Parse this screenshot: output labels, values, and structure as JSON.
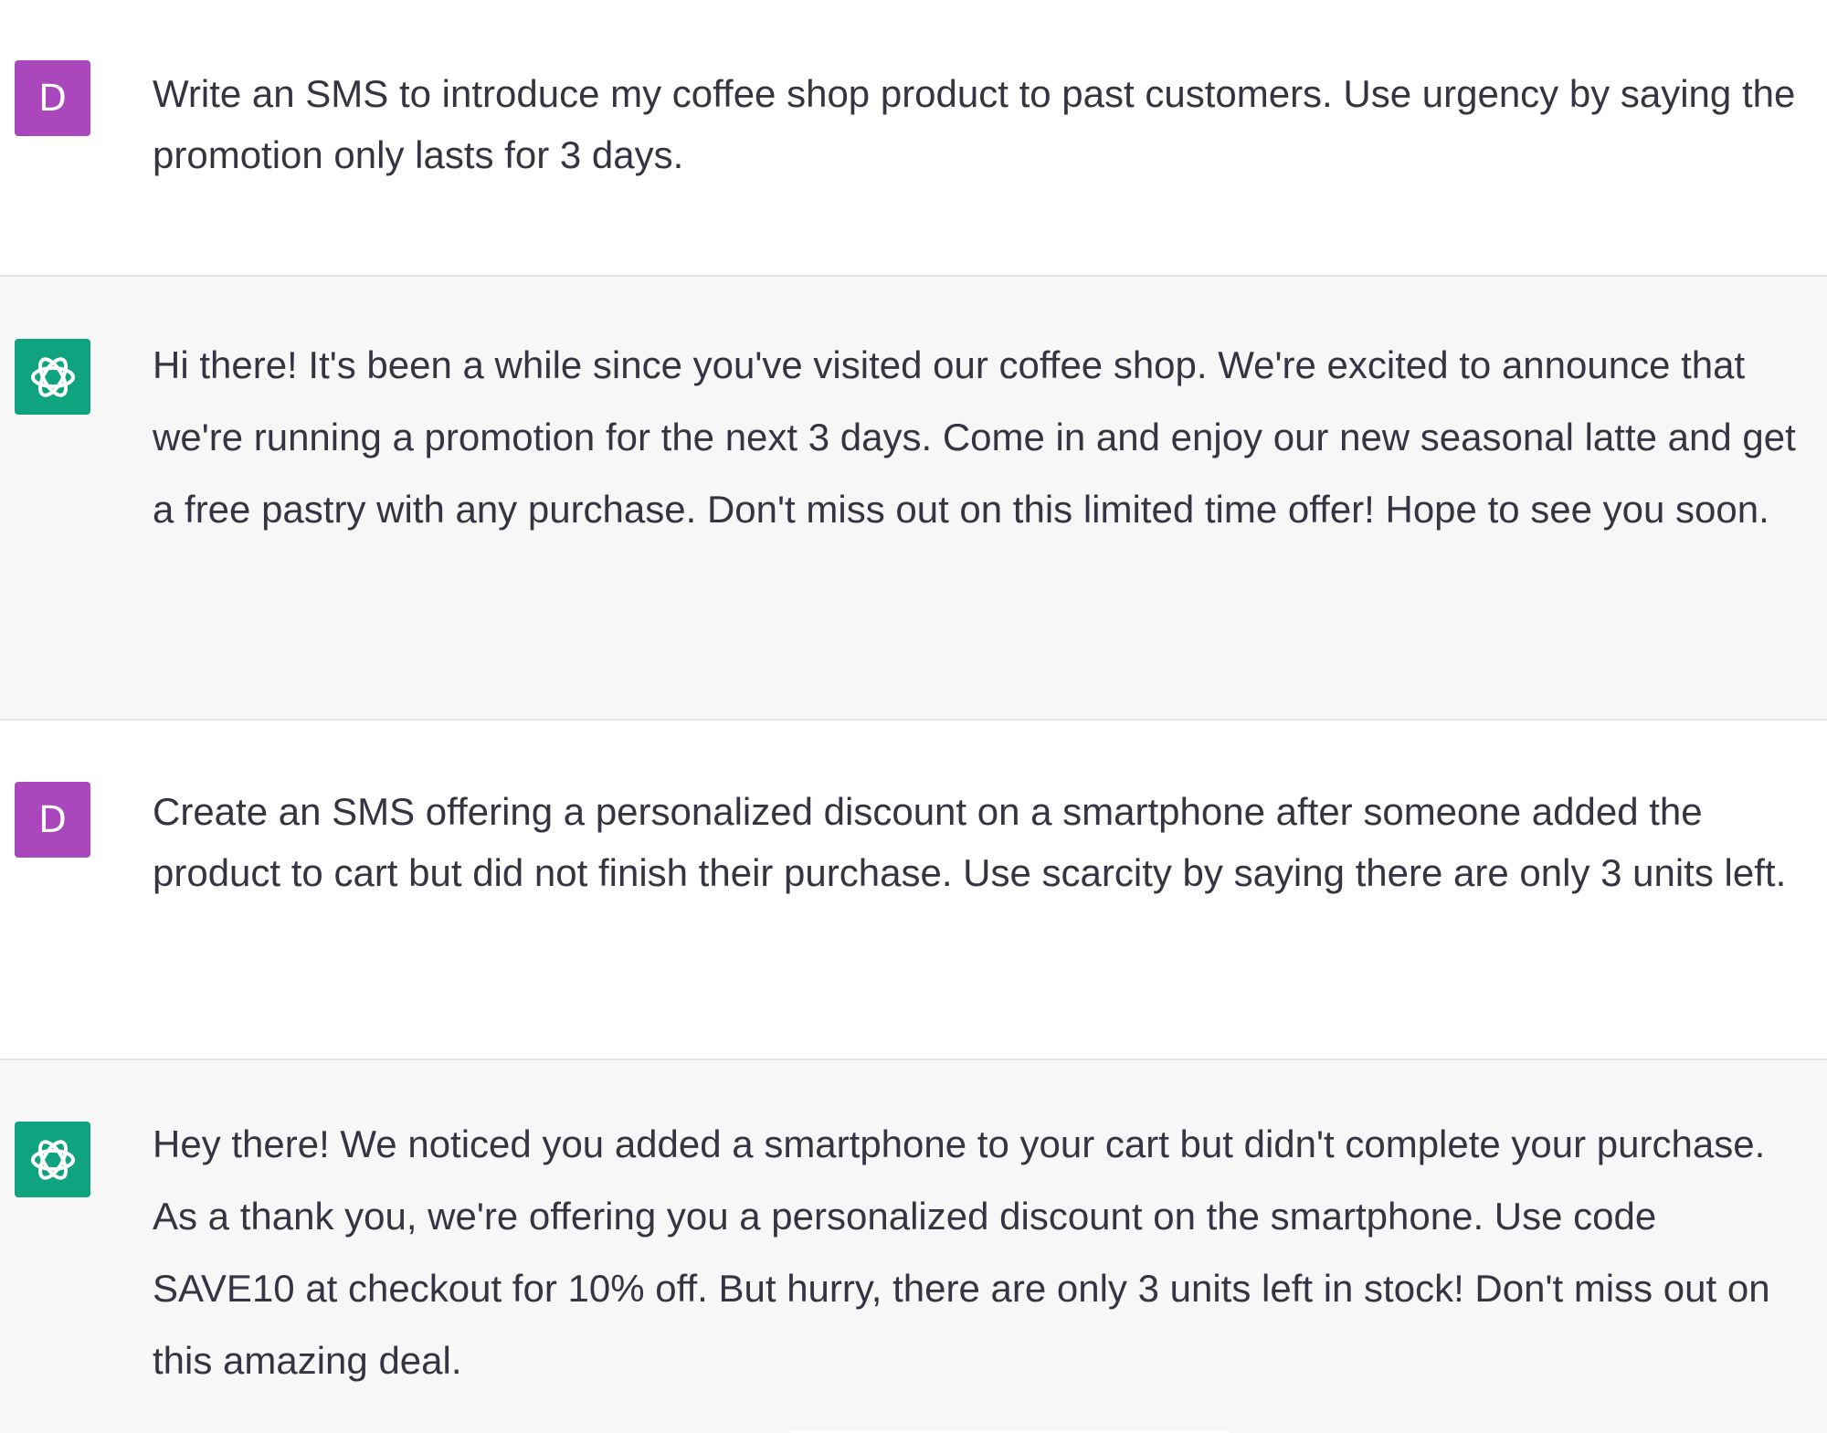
{
  "conversation": {
    "messages": [
      {
        "role": "user",
        "avatar_letter": "D",
        "text": "Write an SMS to introduce my coffee shop product to past customers. Use urgency by saying the promotion only lasts for 3 days."
      },
      {
        "role": "assistant",
        "avatar_icon": "openai-logo-icon",
        "text": "Hi there! It's been a while since you've visited our coffee shop. We're excited to announce that we're running a promotion for the next 3 days. Come in and enjoy our new seasonal latte and get a free pastry with any purchase. Don't miss out on this limited time offer! Hope to see you soon."
      },
      {
        "role": "user",
        "avatar_letter": "D",
        "text": "Create an SMS offering a personalized discount on a smartphone after someone added the product to cart but did not finish their purchase. Use scarcity by saying there are only 3 units left."
      },
      {
        "role": "assistant",
        "avatar_icon": "openai-logo-icon",
        "text": "Hey there! We noticed you added a smartphone to your cart but didn't complete your purchase. As a thank you, we're offering you a personalized discount on the smartphone. Use code SAVE10 at checkout for 10% off. But hurry, there are only 3 units left in stock! Don't miss out on this amazing deal."
      }
    ]
  },
  "colors": {
    "user_avatar": "#ab47bc",
    "assistant_avatar": "#10a37f",
    "assistant_background": "#f7f7f8",
    "text": "#343541"
  }
}
